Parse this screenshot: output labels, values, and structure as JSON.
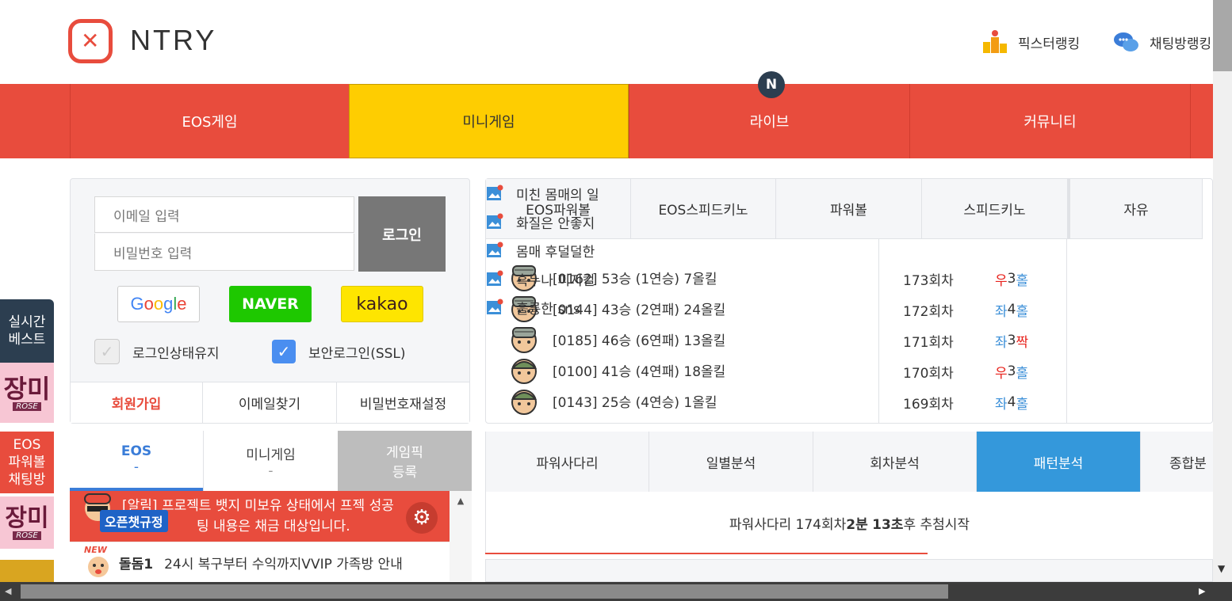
{
  "brand": {
    "logo_text": "NTRY",
    "accent": "#e84c3d"
  },
  "header_links": [
    {
      "label": "픽스터랭킹",
      "icon": "trophy-icon"
    },
    {
      "label": "채팅방랭킹",
      "icon": "chat-bubble-icon"
    }
  ],
  "nav": {
    "items": [
      "EOS게임",
      "미니게임",
      "라이브",
      "커뮤니티"
    ],
    "badge": "N",
    "active": "미니게임"
  },
  "sidebar": {
    "realtime_label": "실시간\n베스트",
    "banner1_text": "장미",
    "banner1_sub": "ROSE",
    "eos_label": "EOS\n파워볼\n채팅방",
    "banner2_text": "장미",
    "banner2_sub": "ROSE"
  },
  "login": {
    "email_placeholder": "이메일 입력",
    "password_placeholder": "비밀번호 입력",
    "login_button": "로그인",
    "google": "Google",
    "naver": "NAVER",
    "kakao": "kakao",
    "keep_login": "로그인상태유지",
    "ssl_login": "보안로그인(SSL)",
    "signup": "회원가입",
    "find_email": "이메일찾기",
    "reset_password": "비밀번호재설정"
  },
  "chat": {
    "tabs": [
      {
        "label": "EOS",
        "sub": "-"
      },
      {
        "label": "미니게임",
        "sub": "-"
      },
      {
        "label": "게임픽",
        "sub": "등록"
      }
    ],
    "notice_line1": "[알림] 프로젝트 뱃지 미보유 상태에서 프젝 성공",
    "notice_line2": "팅 내용은 채금 대상입니다.",
    "rules_badge": "오픈챗규정",
    "room_name": "돌돔1",
    "room_desc": "24시 복구부터 수익까지VVIP 가족방 안내",
    "new_badge": "NEW"
  },
  "game_tabs": [
    "EOS파워볼",
    "EOS스피드키노",
    "파워볼",
    "스피드키노"
  ],
  "free_tab": "자유",
  "pickers": [
    "[0162] 53승 (1연승) 7올킬",
    "[0144] 43승 (2연패) 24올킬",
    "[0185] 46승 (6연패) 13올킬",
    "[0100] 41승 (4연패) 18올킬",
    "[0143] 25승 (4연승) 1올킬"
  ],
  "rounds": [
    {
      "round": "173회차",
      "side": "우",
      "num": "3",
      "oe": "홀"
    },
    {
      "round": "172회차",
      "side": "좌",
      "num": "4",
      "oe": "홀"
    },
    {
      "round": "171회차",
      "side": "좌",
      "num": "3",
      "oe": "짝"
    },
    {
      "round": "170회차",
      "side": "우",
      "num": "3",
      "oe": "홀"
    },
    {
      "round": "169회차",
      "side": "좌",
      "num": "4",
      "oe": "홀"
    }
  ],
  "free_posts": [
    "미친 몸매의 일",
    "화질은 안좋지",
    "몸매 후덜덜한",
    "흑누나 피지컬",
    "훌륭한 sns"
  ],
  "analysis_tabs": [
    "파워사다리",
    "일별분석",
    "회차분석",
    "패턴분석",
    "종합분"
  ],
  "analysis_active": "패턴분석",
  "timer": {
    "prefix": "파워사다리 174회차 ",
    "min": "2분",
    "sec": "13초",
    "suffix": "후 추첨시작"
  },
  "colors": {
    "red": "#e84c3d",
    "yellow": "#fecd01",
    "blue": "#3498db",
    "right_red": "#e8231d",
    "left_blue": "#3b8fd8"
  }
}
